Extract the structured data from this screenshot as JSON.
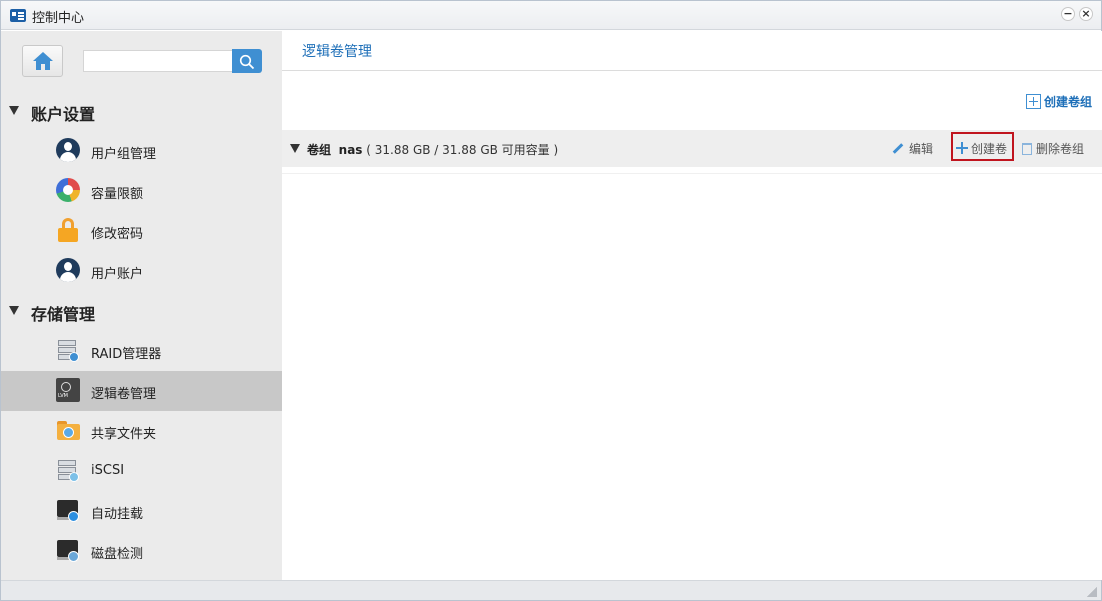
{
  "window": {
    "title": "控制中心",
    "minimize_label": "−",
    "close_label": "×"
  },
  "sidebar": {
    "search_placeholder": "",
    "sections": [
      {
        "label": "账户设置",
        "items": [
          {
            "label": "用户组管理",
            "icon": "user-group-icon"
          },
          {
            "label": "容量限额",
            "icon": "quota-icon"
          },
          {
            "label": "修改密码",
            "icon": "lock-icon"
          },
          {
            "label": "用户账户",
            "icon": "user-icon"
          }
        ]
      },
      {
        "label": "存储管理",
        "items": [
          {
            "label": "RAID管理器",
            "icon": "raid-icon"
          },
          {
            "label": "逻辑卷管理",
            "icon": "lvm-icon",
            "active": true
          },
          {
            "label": "共享文件夹",
            "icon": "shared-folder-icon"
          },
          {
            "label": "iSCSI",
            "icon": "iscsi-icon"
          },
          {
            "label": "自动挂载",
            "icon": "automount-icon"
          },
          {
            "label": "磁盘检测",
            "icon": "disk-check-icon"
          }
        ]
      }
    ]
  },
  "main": {
    "title": "逻辑卷管理",
    "create_volume_group_label": "创建卷组",
    "volume_group": {
      "prefix": "卷组",
      "name": "nas",
      "capacity": "( 31.88 GB / 31.88 GB 可用容量 )",
      "edit_label": "编辑",
      "create_volume_label": "创建卷",
      "delete_label": "删除卷组"
    }
  },
  "colors": {
    "accent": "#1e6fb8",
    "sidebar_bg": "#ebebeb",
    "active_item_bg": "#c8c8c8",
    "highlight_border": "#c0141e"
  }
}
